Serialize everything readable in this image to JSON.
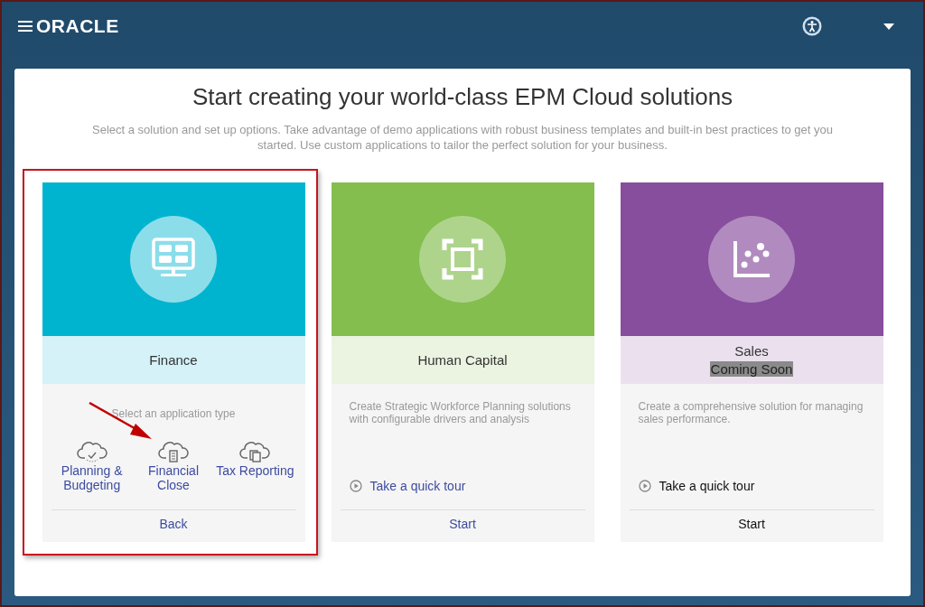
{
  "header": {
    "logo": "ORACLE"
  },
  "title": "Start creating your world-class EPM Cloud solutions",
  "subtitle": "Select a solution and set up options. Take advantage of demo applications with robust business templates and built-in best practices to get you started. Use custom applications to tailor the perfect solution for your business.",
  "solutions": [
    {
      "kind": "app_types",
      "name": "Finance",
      "color": "#00b4d0",
      "highlighted": true,
      "disabled": false,
      "prompt": "Select an application type",
      "app_types": [
        {
          "label": "Planning & Budgeting"
        },
        {
          "label": "Financial Close"
        },
        {
          "label": "Tax Reporting"
        }
      ],
      "footer_link": "Back"
    },
    {
      "kind": "description",
      "name": "Human Capital",
      "color": "#83be4f",
      "highlighted": false,
      "disabled": false,
      "description": "Create Strategic Workforce Planning solutions with configurable drivers and analysis",
      "tour": "Take a quick tour",
      "footer_link": "Start"
    },
    {
      "kind": "description",
      "name": "Sales",
      "badge": "Coming Soon",
      "color": "#874e9d",
      "highlighted": false,
      "disabled": true,
      "description": "Create a comprehensive solution for managing sales performance.",
      "tour": "Take a quick tour",
      "footer_link": "Start"
    }
  ]
}
